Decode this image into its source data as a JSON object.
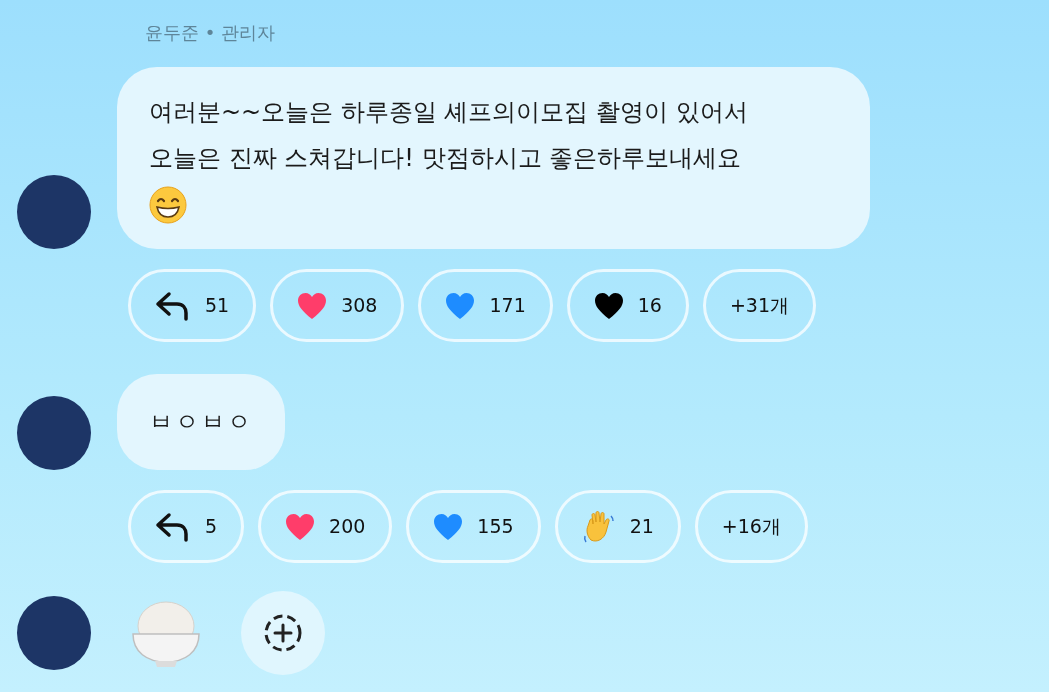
{
  "sender": {
    "name": "윤두준",
    "separator": "•",
    "role": "관리자"
  },
  "messages": [
    {
      "kind": "text",
      "text": "여러분~~오늘은 하루종일 셰프의이모집 촬영이 있어서 오늘은 진짜 스쳐갑니다! 맛점하시고 좋은하루보내세요",
      "emoji_after": true,
      "reactions": [
        {
          "kind": "reply",
          "count": "51"
        },
        {
          "kind": "heart",
          "color": "#ff3d6a",
          "count": "308"
        },
        {
          "kind": "heart",
          "color": "#1e8cff",
          "count": "171"
        },
        {
          "kind": "heart",
          "color": "#000000",
          "count": "16"
        },
        {
          "kind": "more",
          "count": "+31개"
        }
      ]
    },
    {
      "kind": "text",
      "text": "ㅂㅇㅂㅇ",
      "emoji_after": false,
      "reactions": [
        {
          "kind": "reply",
          "count": "5"
        },
        {
          "kind": "heart",
          "color": "#ff3d6a",
          "count": "200"
        },
        {
          "kind": "heart",
          "color": "#1e8cff",
          "count": "155"
        },
        {
          "kind": "wave",
          "count": "21"
        },
        {
          "kind": "more",
          "count": "+16개"
        }
      ]
    },
    {
      "kind": "emoji",
      "add_reaction": true
    }
  ]
}
